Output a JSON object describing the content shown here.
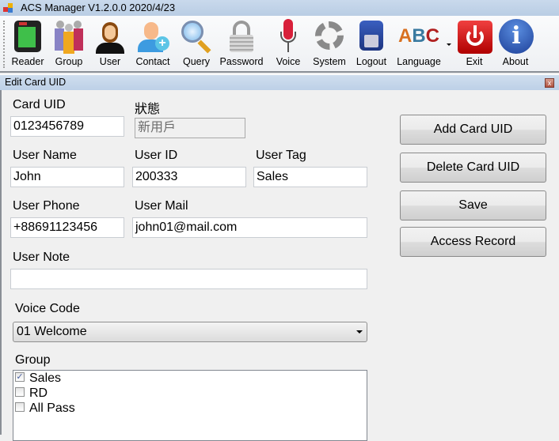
{
  "window": {
    "title": "ACS Manager V1.2.0.0  2020/4/23"
  },
  "toolbar": {
    "items": [
      {
        "label": "Reader",
        "icon": "card-reader-icon"
      },
      {
        "label": "Group",
        "icon": "group-icon"
      },
      {
        "label": "User",
        "icon": "user-icon"
      },
      {
        "label": "Contact",
        "icon": "add-contact-icon"
      },
      {
        "label": "Query",
        "icon": "magnifier-icon"
      },
      {
        "label": "Password",
        "icon": "padlock-icon"
      },
      {
        "label": "Voice",
        "icon": "microphone-icon"
      },
      {
        "label": "System",
        "icon": "gear-icon"
      },
      {
        "label": "Logout",
        "icon": "robot-head-icon"
      },
      {
        "label": "Language",
        "icon": "abc-icon"
      },
      {
        "label": "Exit",
        "icon": "power-icon"
      },
      {
        "label": "About",
        "icon": "info-icon"
      }
    ]
  },
  "child": {
    "title": "Edit Card UID",
    "close": "x"
  },
  "form": {
    "card_uid": {
      "label": "Card UID",
      "value": "0123456789"
    },
    "status": {
      "label": "狀態",
      "value": "新用戶"
    },
    "user_name": {
      "label": "User Name",
      "value": "John"
    },
    "user_id": {
      "label": "User ID",
      "value": "200333"
    },
    "user_tag": {
      "label": "User Tag",
      "value": "Sales"
    },
    "user_phone": {
      "label": "User Phone",
      "value": "+88691123456"
    },
    "user_mail": {
      "label": "User Mail",
      "value": "john01@mail.com"
    },
    "user_note": {
      "label": "User Note",
      "value": ""
    },
    "voice_code": {
      "label": "Voice Code",
      "value": "01 Welcome"
    },
    "group": {
      "label": "Group",
      "items": [
        {
          "label": "Sales",
          "checked": true,
          "mark": "✓"
        },
        {
          "label": "RD",
          "checked": false
        },
        {
          "label": "All Pass",
          "checked": false
        }
      ]
    }
  },
  "buttons": {
    "add": "Add Card UID",
    "delete": "Delete Card UID",
    "save": "Save",
    "access": "Access Record"
  }
}
